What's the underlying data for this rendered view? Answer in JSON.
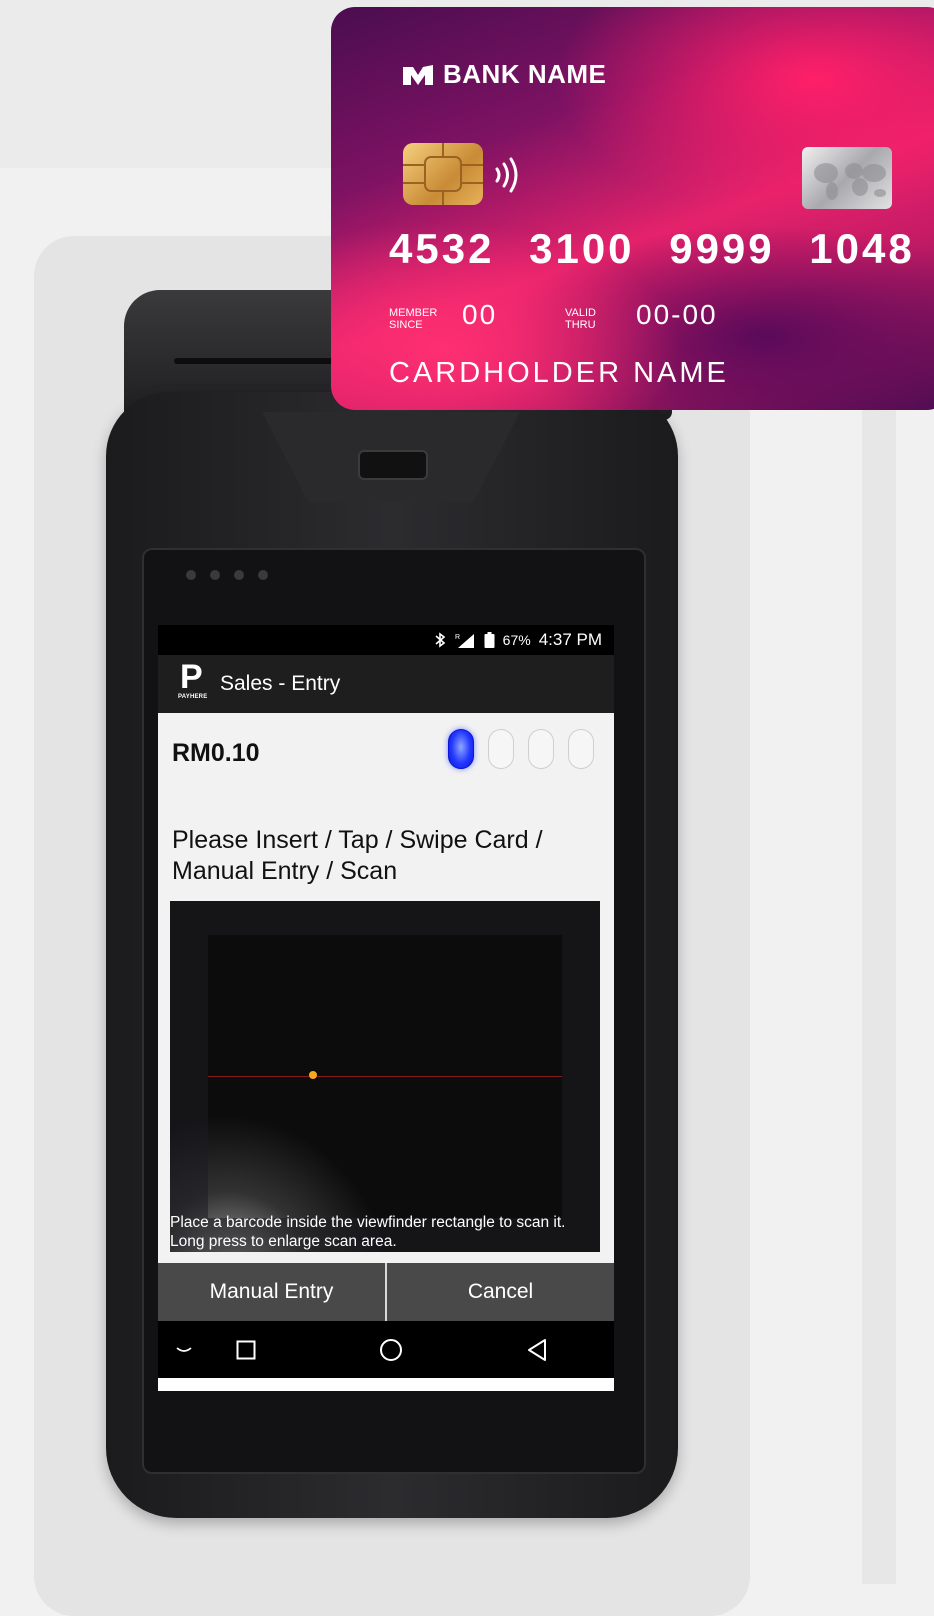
{
  "card": {
    "bank_name": "BANK NAME",
    "number": "4532 3100 9999 1048",
    "member_since_label": "MEMBER SINCE",
    "member_since_value": "00",
    "valid_thru_label": "VALID THRU",
    "valid_thru_value": "00-00",
    "cardholder": "CARDHOLDER NAME"
  },
  "status_bar": {
    "battery_percent": "67%",
    "time": "4:37 PM",
    "icons": [
      "bluetooth-icon",
      "signal-roaming-icon",
      "battery-icon"
    ]
  },
  "app_bar": {
    "logo_text": "PAYHERE",
    "title": "Sales - Entry"
  },
  "entry": {
    "amount": "RM0.10",
    "progress_steps": 4,
    "progress_current": 1,
    "instruction": "Please Insert / Tap / Swipe Card / Manual Entry / Scan",
    "scanner_hint": "Place a barcode inside the viewfinder rectangle to scan it. Long press to enlarge scan area."
  },
  "actions": {
    "manual_entry": "Manual Entry",
    "cancel": "Cancel"
  },
  "nav": {
    "icons": [
      "hide-keyboard-icon",
      "recents-icon",
      "home-icon",
      "back-icon"
    ]
  },
  "colors": {
    "progress_active": "#1a2cff",
    "action_bar": "#494949",
    "app_bar": "#1e1e1e",
    "card_pink": "#e5226b",
    "card_purple": "#4a0d4f"
  }
}
